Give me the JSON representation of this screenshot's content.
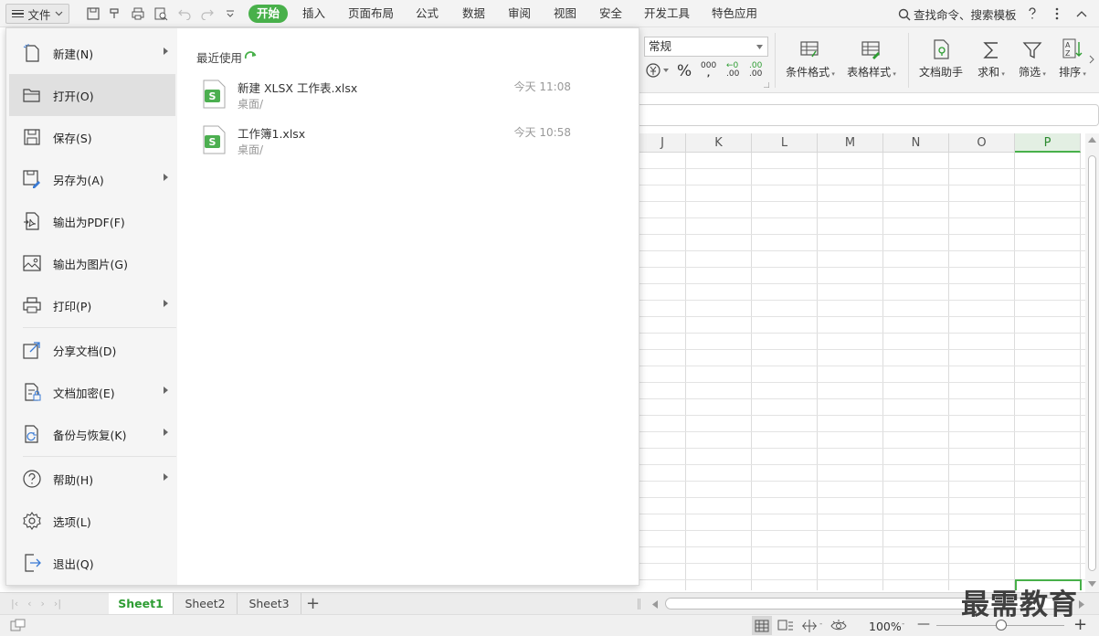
{
  "menubar": {
    "file_label": "文件",
    "tabs": [
      "开始",
      "插入",
      "页面布局",
      "公式",
      "数据",
      "审阅",
      "视图",
      "安全",
      "开发工具",
      "特色应用"
    ],
    "search_label": "查找命令、搜索模板"
  },
  "ribbon": {
    "number_format": "常规",
    "percent": "%",
    "thousands": "000",
    "dec_increase": ".00",
    "dec_decrease": ".00",
    "buttons": [
      "条件格式",
      "表格样式",
      "文档助手",
      "求和",
      "筛选",
      "排序"
    ]
  },
  "grid": {
    "columns": [
      "J",
      "K",
      "L",
      "M",
      "N",
      "O",
      "P"
    ],
    "selected_column": "P"
  },
  "file_menu": {
    "items": [
      {
        "label": "新建(N)",
        "icon": "new-doc-icon",
        "arrow": true
      },
      {
        "label": "打开(O)",
        "icon": "open-folder-icon",
        "arrow": false
      },
      {
        "label": "保存(S)",
        "icon": "save-icon",
        "arrow": false
      },
      {
        "label": "另存为(A)",
        "icon": "save-as-icon",
        "arrow": true
      },
      {
        "label": "输出为PDF(F)",
        "icon": "pdf-export-icon",
        "arrow": false
      },
      {
        "label": "输出为图片(G)",
        "icon": "image-export-icon",
        "arrow": false
      },
      {
        "label": "打印(P)",
        "icon": "print-icon",
        "arrow": true
      },
      {
        "label": "分享文档(D)",
        "icon": "share-icon",
        "arrow": false
      },
      {
        "label": "文档加密(E)",
        "icon": "encrypt-icon",
        "arrow": true
      },
      {
        "label": "备份与恢复(K)",
        "icon": "backup-icon",
        "arrow": true
      },
      {
        "label": "帮助(H)",
        "icon": "help-icon",
        "arrow": true
      },
      {
        "label": "选项(L)",
        "icon": "gear-icon",
        "arrow": false
      },
      {
        "label": "退出(Q)",
        "icon": "exit-icon",
        "arrow": false
      }
    ],
    "recent_title": "最近使用",
    "recent_files": [
      {
        "name": "新建 XLSX 工作表.xlsx",
        "path": "桌面/",
        "time": "今天 11:08"
      },
      {
        "name": "工作簿1.xlsx",
        "path": "桌面/",
        "time": "今天 10:58"
      }
    ]
  },
  "sheets": [
    "Sheet1",
    "Sheet2",
    "Sheet3"
  ],
  "active_sheet": "Sheet1",
  "status": {
    "zoom": "100%",
    "zoom_arrow": "-",
    "zoom_minus": "—",
    "zoom_plus": "+"
  },
  "watermark": "最需教育",
  "colors": {
    "accent": "#48b04a",
    "file_icon_green": "#4caf50"
  }
}
